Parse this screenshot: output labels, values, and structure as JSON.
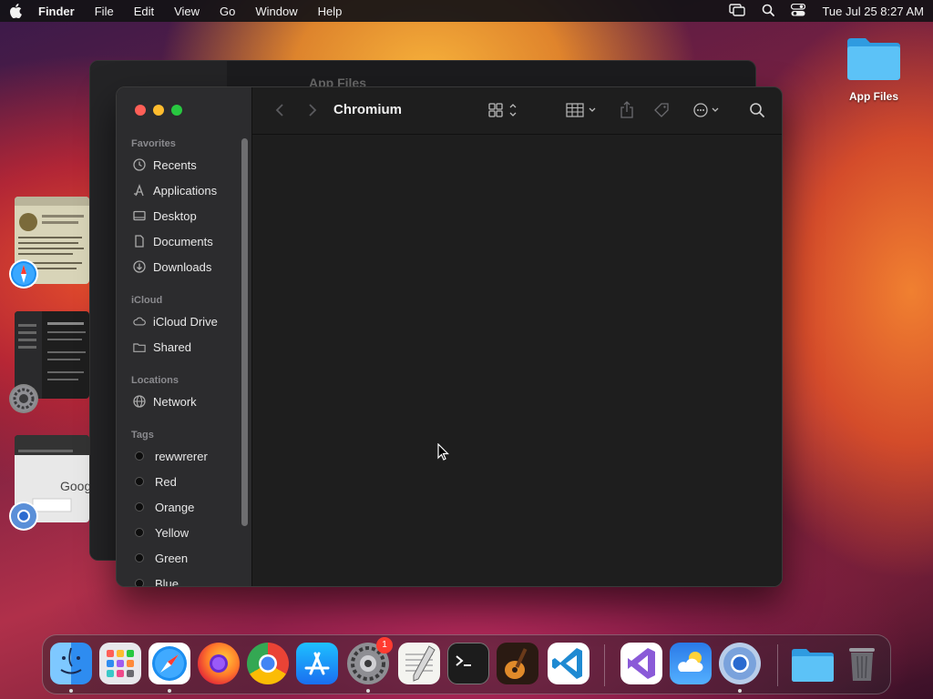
{
  "menubar": {
    "app": "Finder",
    "menus": [
      "File",
      "Edit",
      "View",
      "Go",
      "Window",
      "Help"
    ],
    "clock": "Tue Jul 25  8:27 AM"
  },
  "desktop": {
    "icon_label": "App Files"
  },
  "background_window": {
    "title": "App Files"
  },
  "finder": {
    "title": "Chromium",
    "sidebar": {
      "favorites_header": "Favorites",
      "favorites": [
        "Recents",
        "Applications",
        "Desktop",
        "Documents",
        "Downloads"
      ],
      "icloud_header": "iCloud",
      "icloud": [
        "iCloud Drive",
        "Shared"
      ],
      "locations_header": "Locations",
      "locations": [
        "Network"
      ],
      "tags_header": "Tags",
      "tags": [
        "rewwrerer",
        "Red",
        "Orange",
        "Yellow",
        "Green",
        "Blue"
      ]
    }
  },
  "thumbnail_text": "Goog",
  "dock": {
    "settings_badge": "1"
  },
  "colors": {
    "close": "#ff5f57",
    "minimize": "#febc2e",
    "maximize": "#28c840",
    "badge": "#ff3b30"
  }
}
